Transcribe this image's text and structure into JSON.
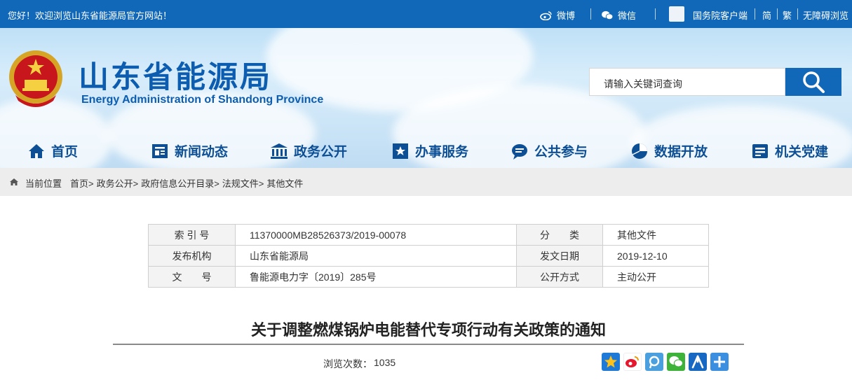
{
  "topbar": {
    "welcome": "您好！欢迎浏览山东省能源局官方网站！",
    "weibo": "微博",
    "wechat": "微信",
    "gov_client": "国务院客户端",
    "simplified": "简",
    "traditional": "繁",
    "accessible": "无障碍浏览"
  },
  "header": {
    "title": "山东省能源局",
    "subtitle": "Energy Administration of Shandong Province",
    "search_placeholder": "请输入关键词查询"
  },
  "nav": [
    {
      "label": "首页",
      "icon": "home-icon"
    },
    {
      "label": "新闻动态",
      "icon": "news-icon"
    },
    {
      "label": "政务公开",
      "icon": "government-icon"
    },
    {
      "label": "办事服务",
      "icon": "service-icon"
    },
    {
      "label": "公共参与",
      "icon": "chat-icon"
    },
    {
      "label": "数据开放",
      "icon": "pie-icon"
    },
    {
      "label": "机关党建",
      "icon": "party-icon"
    }
  ],
  "breadcrumb": {
    "prefix": "当前位置",
    "items": [
      "首页>",
      "政务公开>",
      "政府信息公开目录>",
      "法规文件>",
      "其他文件"
    ]
  },
  "info_table": [
    {
      "k1": "索 引 号",
      "v1": "11370000MB28526373/2019-00078",
      "k2": "分　　类",
      "v2": "其他文件"
    },
    {
      "k1": "发布机构",
      "v1": "山东省能源局",
      "k2": "发文日期",
      "v2": "2019-12-10"
    },
    {
      "k1": "文　　号",
      "v1": "鲁能源电力字〔2019〕285号",
      "k2": "公开方式",
      "v2": "主动公开"
    }
  ],
  "article": {
    "title": "关于调整燃煤锅炉电能替代专项行动有关政策的通知",
    "views_label": "浏览次数：",
    "views_count": "1035"
  },
  "share_icons": [
    "qzone-icon",
    "weibo-share-icon",
    "tencent-weibo-icon",
    "wechat-share-icon",
    "renren-icon",
    "more-share-icon"
  ],
  "colors": {
    "brand": "#1168b8",
    "nav_text": "#0d4f95",
    "title": "#0c5cb0"
  }
}
